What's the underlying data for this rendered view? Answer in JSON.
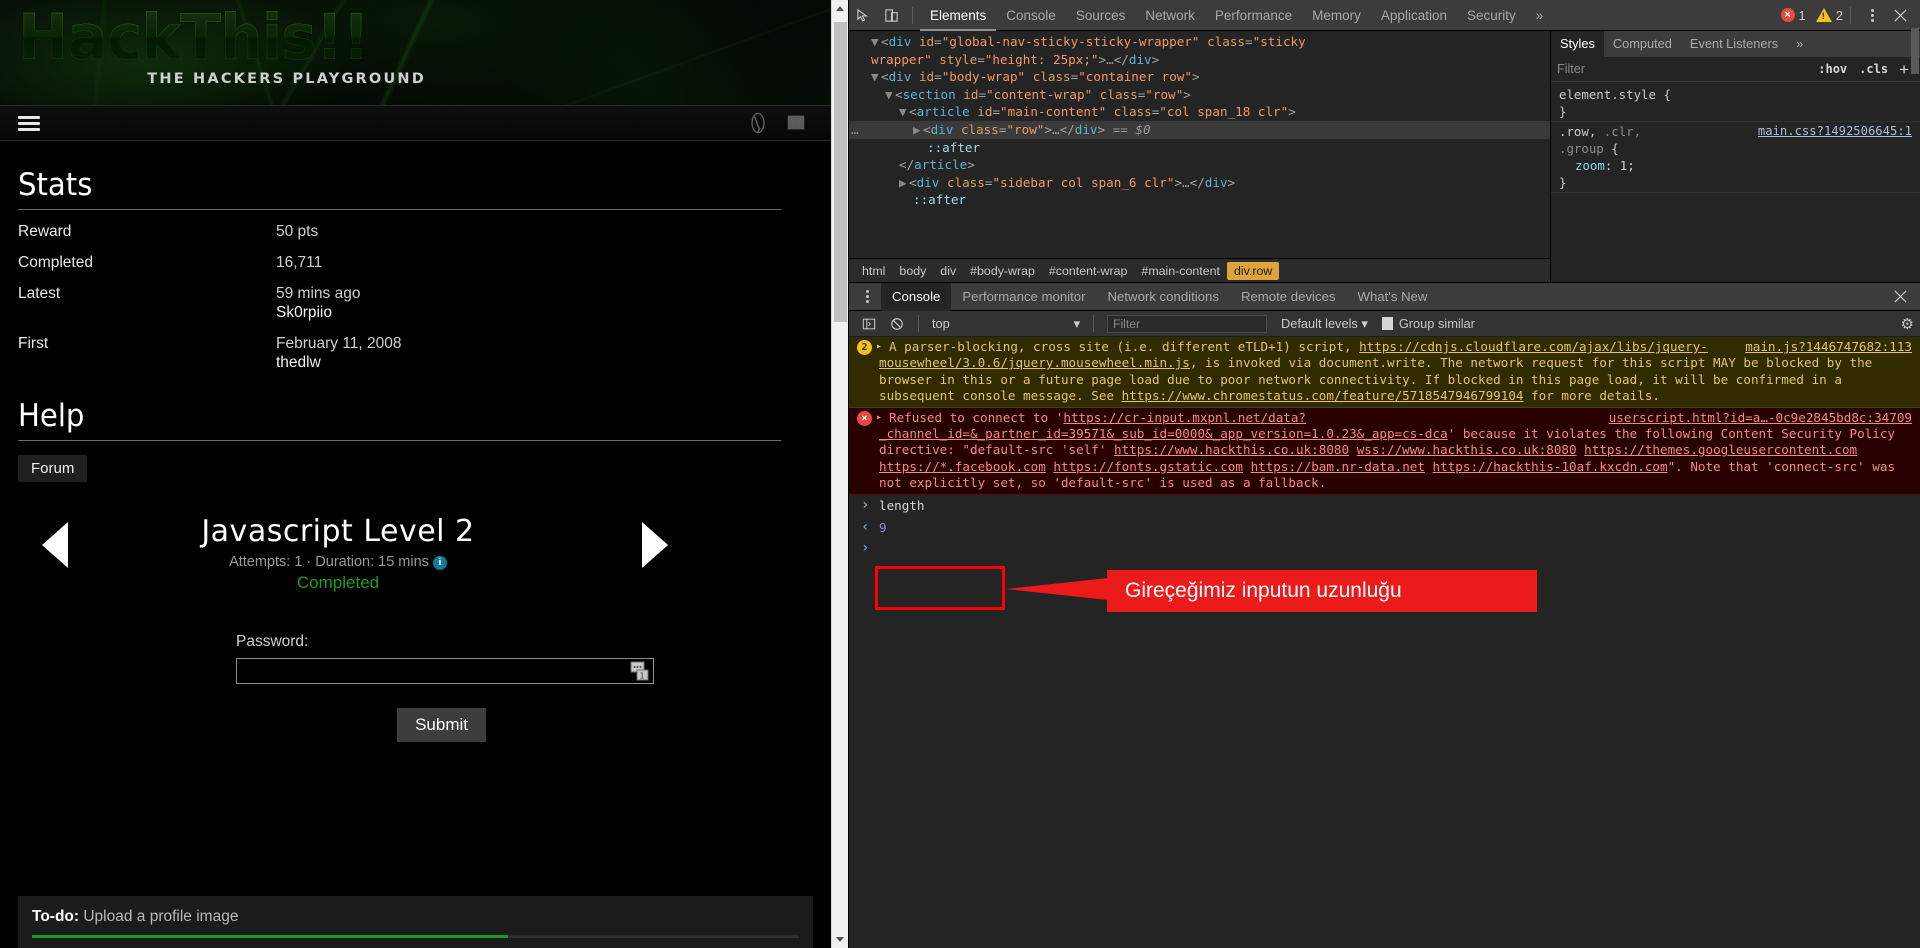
{
  "site": {
    "logo_text": "HackThis!!",
    "logo_subtitle": "THE HACKERS PLAYGROUND",
    "nav": {
      "menu_icon": "hamburger-icon",
      "globe_icon": "globe-icon",
      "mail_icon": "envelope-icon"
    }
  },
  "stats": {
    "heading": "Stats",
    "rows": [
      {
        "label": "Reward",
        "value": "50 pts",
        "sub": ""
      },
      {
        "label": "Completed",
        "value": "16,711",
        "sub": ""
      },
      {
        "label": "Latest",
        "value": "59 mins ago",
        "sub": "Sk0rpiio"
      },
      {
        "label": "First",
        "value": "February 11, 2008",
        "sub": "thedlw"
      }
    ]
  },
  "help": {
    "heading": "Help",
    "forum_label": "Forum"
  },
  "level": {
    "prev_icon": "arrow-left-icon",
    "next_icon": "arrow-right-icon",
    "title": "Javascript Level 2",
    "meta": "Attempts: 1 · Duration: 15 mins",
    "info_icon": "info-icon",
    "status": "Completed",
    "password_label": "Password:",
    "password_value": "",
    "password_placeholder": "",
    "password_field_icon": "password-manager-icon",
    "submit_label": "Submit"
  },
  "todo": {
    "prefix": "To-do:",
    "text": "Upload a profile image",
    "progress_percent": 62,
    "progress_color": "#1c9c1c"
  },
  "devtools": {
    "toolbar": {
      "inspect_icon": "inspect-cursor-icon",
      "device_icon": "device-toggle-icon",
      "tabs": [
        {
          "label": "Elements",
          "active": true
        },
        {
          "label": "Console",
          "active": false
        },
        {
          "label": "Sources",
          "active": false
        },
        {
          "label": "Network",
          "active": false
        },
        {
          "label": "Performance",
          "active": false
        },
        {
          "label": "Memory",
          "active": false
        },
        {
          "label": "Application",
          "active": false
        },
        {
          "label": "Security",
          "active": false
        }
      ],
      "more_icon": "chevron-double-right-icon",
      "error_count": "1",
      "warning_count": "2",
      "settings_icon": "kebab-menu-icon",
      "close_icon": "close-icon"
    },
    "dom_tree": [
      {
        "indent": 1,
        "html": "<span class=\"tri\">▼</span><span class=\"punc\">&lt;</span><span class=\"tagn\">div</span> <span class=\"attrn\">id</span><span class=\"punc\">=</span><span class=\"attrv\">\"global-nav-sticky-sticky-wrapper\"</span> <span class=\"attrn\">class</span><span class=\"punc\">=</span><span class=\"attrv\">\"sticky</span>"
      },
      {
        "indent": 1,
        "html": "<span class=\"attrv\">wrapper\"</span> <span class=\"attrn\">style</span><span class=\"punc\">=</span><span class=\"attrv\">\"height: 25px;\"</span><span class=\"punc\">&gt;</span><span class=\"ellip\">…</span><span class=\"punc\">&lt;/</span><span class=\"tagn\">div</span><span class=\"punc\">&gt;</span>"
      },
      {
        "indent": 1,
        "html": "<span class=\"tri\">▼</span><span class=\"punc\">&lt;</span><span class=\"tagn\">div</span> <span class=\"attrn\">id</span><span class=\"punc\">=</span><span class=\"attrv\">\"body-wrap\"</span> <span class=\"attrn\">class</span><span class=\"punc\">=</span><span class=\"attrv\">\"container row\"</span><span class=\"punc\">&gt;</span>"
      },
      {
        "indent": 2,
        "html": "<span class=\"tri\">▼</span><span class=\"punc\">&lt;</span><span class=\"tagn\">section</span> <span class=\"attrn\">id</span><span class=\"punc\">=</span><span class=\"attrv\">\"content-wrap\"</span> <span class=\"attrn\">class</span><span class=\"punc\">=</span><span class=\"attrv\">\"row\"</span><span class=\"punc\">&gt;</span>"
      },
      {
        "indent": 3,
        "html": "<span class=\"tri\">▼</span><span class=\"punc\">&lt;</span><span class=\"tagn\">article</span> <span class=\"attrn\">id</span><span class=\"punc\">=</span><span class=\"attrv\">\"main-content\"</span> <span class=\"attrn\">class</span><span class=\"punc\">=</span><span class=\"attrv\">\"col span_18 clr\"</span><span class=\"punc\">&gt;</span>"
      },
      {
        "indent": 4,
        "selected": true,
        "html": "<span class=\"tri\">▶</span><span class=\"punc\">&lt;</span><span class=\"tagn\">div</span> <span class=\"attrn\">class</span><span class=\"punc\">=</span><span class=\"attrv\">\"row\"</span><span class=\"punc\">&gt;</span><span class=\"ellip\">…</span><span class=\"punc\">&lt;/</span><span class=\"tagn\">div</span><span class=\"punc\">&gt;</span> <span class=\"dollar\">== $0</span>"
      },
      {
        "indent": 5,
        "html": "<span class=\"pseudo\">::after</span>"
      },
      {
        "indent": 3,
        "html": "<span class=\"punc\">&lt;/</span><span class=\"tagn\">article</span><span class=\"punc\">&gt;</span>"
      },
      {
        "indent": 3,
        "html": "<span class=\"tri\">▶</span><span class=\"punc\">&lt;</span><span class=\"tagn\">div</span> <span class=\"attrn\">class</span><span class=\"punc\">=</span><span class=\"attrv\">\"sidebar col span_6 clr\"</span><span class=\"punc\">&gt;</span><span class=\"ellip\">…</span><span class=\"punc\">&lt;/</span><span class=\"tagn\">div</span><span class=\"punc\">&gt;</span>"
      },
      {
        "indent": 4,
        "html": "<span class=\"pseudo\">::after</span>"
      }
    ],
    "breadcrumbs": [
      {
        "label": "html",
        "active": false
      },
      {
        "label": "body",
        "active": false
      },
      {
        "label": "div",
        "active": false
      },
      {
        "label": "#body-wrap",
        "active": false
      },
      {
        "label": "#content-wrap",
        "active": false
      },
      {
        "label": "#main-content",
        "active": false
      },
      {
        "label": "div.row",
        "active": true
      }
    ],
    "styles": {
      "tabs": [
        {
          "label": "Styles",
          "active": true
        },
        {
          "label": "Computed",
          "active": false
        },
        {
          "label": "Event Listeners",
          "active": false
        }
      ],
      "more_icon": "chevron-double-right-icon",
      "filter_placeholder": "Filter",
      "hov_label": ":hov",
      "cls_label": ".cls",
      "add_rule_icon": "plus-icon",
      "rules": [
        {
          "selector_main": "element.style",
          "selector_dim": "",
          "origin": "",
          "declarations": []
        },
        {
          "selector_main": ".row,",
          "selector_dim": " .clr,",
          "selector_line2_dim": ".group",
          "origin": "main.css?1492506645:1",
          "declarations": [
            {
              "prop": "zoom",
              "value": "1;"
            }
          ]
        }
      ]
    },
    "drawer": {
      "menu_icon": "kebab-menu-icon",
      "tabs": [
        {
          "label": "Console",
          "active": true
        },
        {
          "label": "Performance monitor",
          "active": false
        },
        {
          "label": "Network conditions",
          "active": false
        },
        {
          "label": "Remote devices",
          "active": false
        },
        {
          "label": "What's New",
          "active": false
        }
      ],
      "close_icon": "close-icon"
    },
    "console_toolbar": {
      "sidebar_icon": "console-sidebar-icon",
      "clear_icon": "clear-console-icon",
      "context": "top",
      "context_caret_icon": "chevron-down-icon",
      "filter_placeholder": "Filter",
      "levels_label": "Default levels",
      "levels_caret_icon": "chevron-down-icon",
      "group_similar_label": "Group similar",
      "group_similar_checked": true,
      "settings_icon": "gear-icon"
    },
    "console_messages": [
      {
        "type": "warn",
        "count": "2",
        "source": "main.js?1446747682:113",
        "parts": [
          {
            "t": "text",
            "v": "A parser-blocking, cross site (i.e. different eTLD+1) script, "
          },
          {
            "t": "link",
            "v": "https://cdnjs.cloudflare.com/ajax/libs/jquery-mousewheel/3.0.6/jquery.mousewheel.min.js"
          },
          {
            "t": "text",
            "v": ", is invoked via document.write. The network request for this script MAY be blocked by the browser in this or a future page load due to poor network connectivity. If blocked in this page load, it will be confirmed in a subsequent console message. See "
          },
          {
            "t": "link",
            "v": "https://www.chromestatus.com/feature/5718547946799104"
          },
          {
            "t": "text",
            "v": " for more details."
          }
        ]
      },
      {
        "type": "err",
        "count": "",
        "source": "userscript.html?id=a…-0c9e2845bd8c:34709",
        "parts": [
          {
            "t": "text",
            "v": "Refused to connect to '"
          },
          {
            "t": "link",
            "v": "https://cr-input.mxpnl.net/data?_channel_id=&_partner_id=39571&_sub_id=0000&_app_version=1.0.23&_app=cs-dca"
          },
          {
            "t": "text",
            "v": "' because it violates the following Content Security Policy directive: \"default-src 'self' "
          },
          {
            "t": "link",
            "v": "https://www.hackthis.co.uk:8080"
          },
          {
            "t": "text",
            "v": " "
          },
          {
            "t": "link",
            "v": "wss://www.hackthis.co.uk:8080"
          },
          {
            "t": "text",
            "v": " "
          },
          {
            "t": "link",
            "v": "https://themes.googleusercontent.com"
          },
          {
            "t": "text",
            "v": " "
          },
          {
            "t": "link",
            "v": "https://*.facebook.com"
          },
          {
            "t": "text",
            "v": " "
          },
          {
            "t": "link",
            "v": "https://fonts.gstatic.com"
          },
          {
            "t": "text",
            "v": " "
          },
          {
            "t": "link",
            "v": "https://bam.nr-data.net"
          },
          {
            "t": "text",
            "v": " "
          },
          {
            "t": "link",
            "v": "https://hackthis-10af.kxcdn.com"
          },
          {
            "t": "text",
            "v": "\". Note that 'connect-src' was not explicitly set, so 'default-src' is used as a fallback."
          }
        ]
      }
    ],
    "console_input": "length",
    "console_output": "9",
    "annotation": {
      "text": "Gireçeğimiz inputun uzunluğu",
      "color": "#ec1b1b"
    }
  }
}
